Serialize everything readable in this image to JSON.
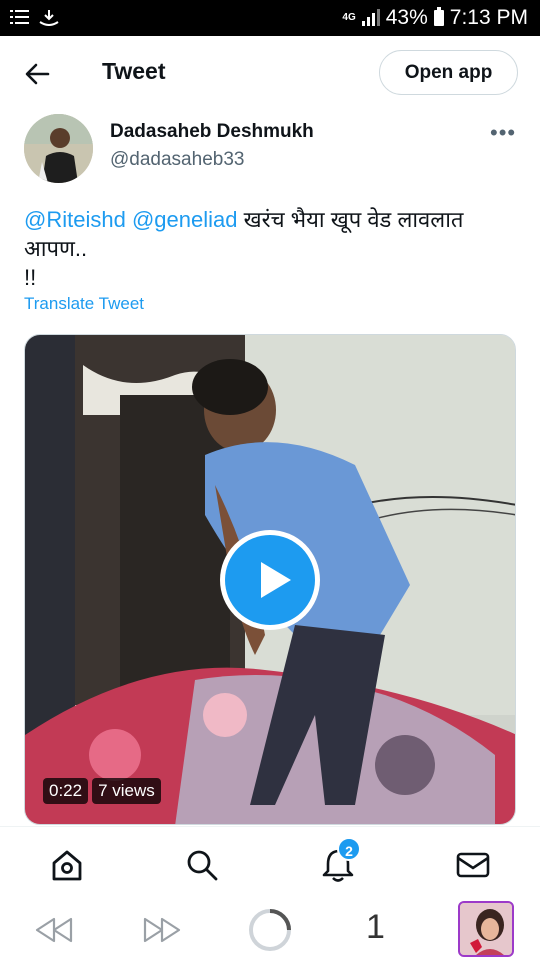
{
  "status": {
    "network": "4G",
    "battery": "43%",
    "time": "7:13 PM"
  },
  "header": {
    "title": "Tweet",
    "open_app_label": "Open app"
  },
  "author": {
    "name": "Dadasaheb Deshmukh",
    "handle": "@dadasaheb33"
  },
  "tweet": {
    "mention1": "@Riteishd",
    "mention2": "@geneliad",
    "text": "खरंच भैया खूप वेड लावलात आपण..",
    "text2": "!!",
    "translate_label": "Translate Tweet"
  },
  "video": {
    "duration": "0:22",
    "views": "7 views"
  },
  "tabbar": {
    "notification_count": "2"
  },
  "browser": {
    "tab_count": "1"
  },
  "colors": {
    "accent": "#1d9bf0",
    "text": "#0f1419",
    "secondary": "#536471"
  }
}
